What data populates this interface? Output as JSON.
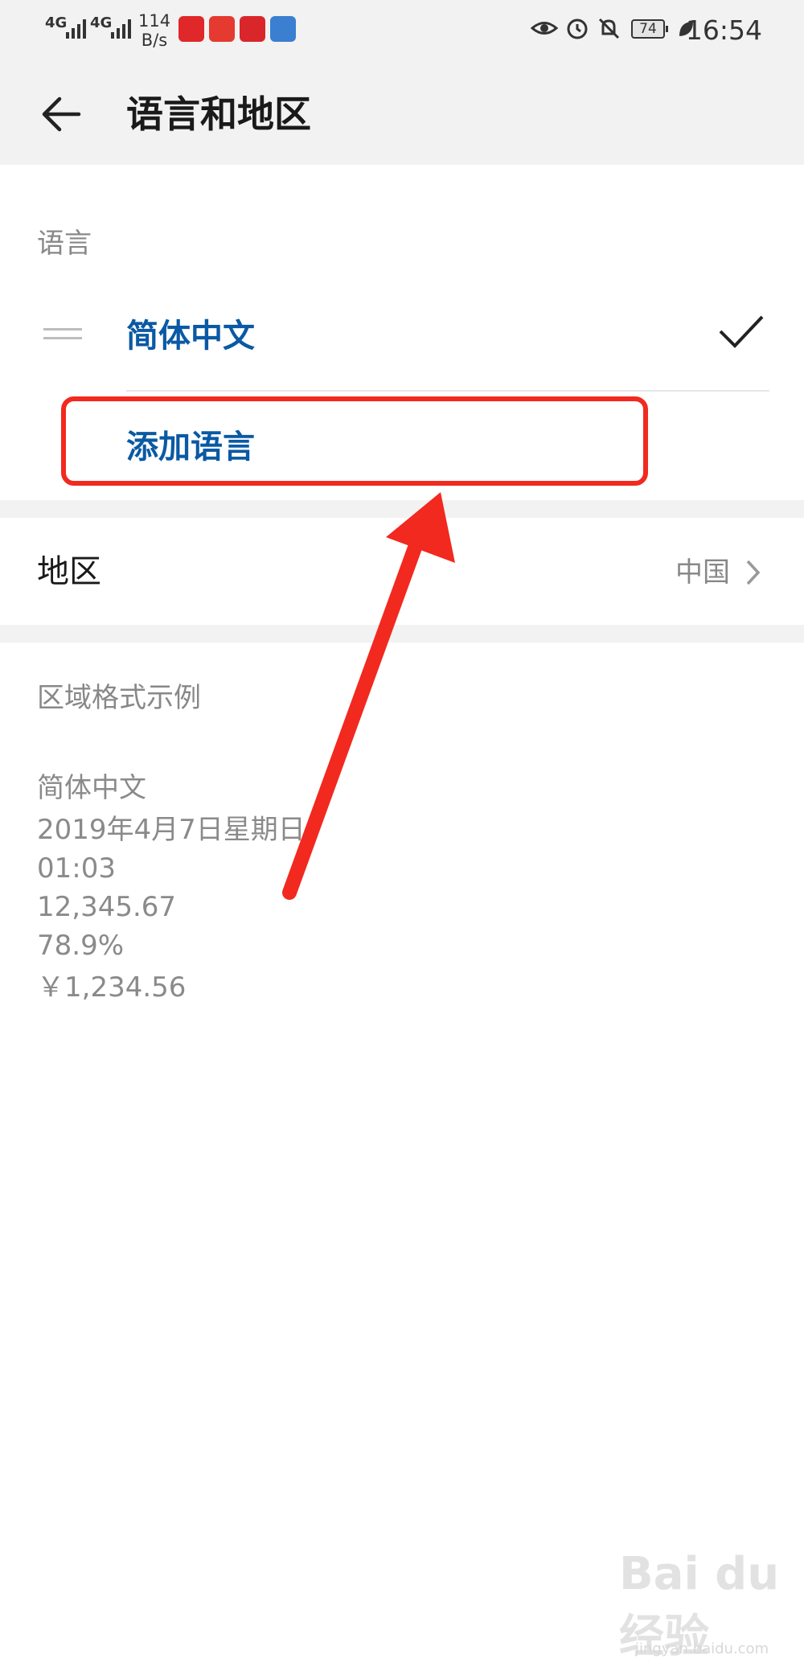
{
  "status_bar": {
    "signal1": "4G",
    "signal2": "4G",
    "net_speed_value": "114",
    "net_speed_unit": "B/s",
    "battery": "74",
    "time": "16:54",
    "icons": [
      "eye-comfort-icon",
      "alarm-icon",
      "mute-icon",
      "battery-icon",
      "leaf-icon"
    ]
  },
  "header": {
    "title": "语言和地区"
  },
  "language_section": {
    "label": "语言",
    "items": [
      {
        "label": "简体中文",
        "selected": true
      }
    ],
    "add_label": "添加语言"
  },
  "region": {
    "label": "地区",
    "value": "中国"
  },
  "format_example": {
    "label": "区域格式示例",
    "lines": [
      "简体中文",
      "2019年4月7日星期日",
      "01:03",
      "12,345.67",
      "78.9%",
      "￥1,234.56"
    ]
  },
  "watermark": {
    "text": "Bai du 经验",
    "sub": "jingyan.baidu.com"
  },
  "colors": {
    "accent": "#0a59a4",
    "highlight": "#f2291f",
    "background": "#ffffff",
    "header_bg": "#f2f2f2"
  }
}
